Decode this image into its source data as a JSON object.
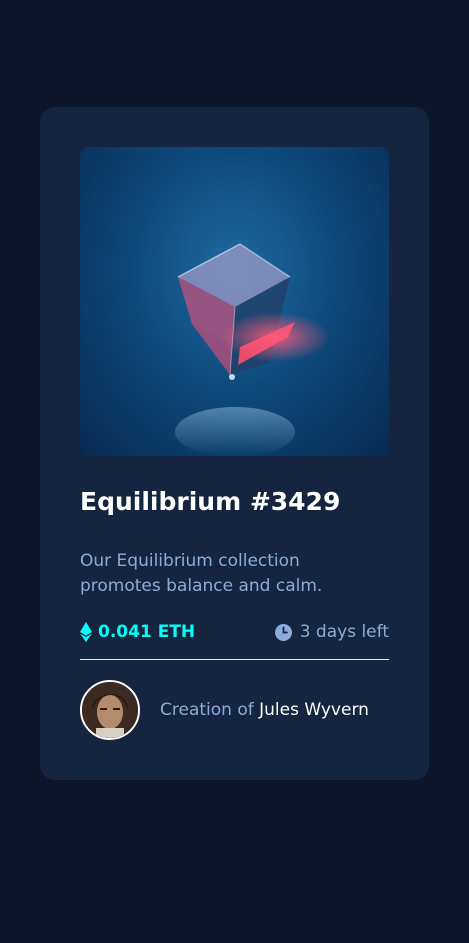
{
  "card": {
    "title": "Equilibrium #3429",
    "description": "Our Equilibrium collection promotes balance and calm.",
    "price": "0.041 ETH",
    "time_left": "3 days left",
    "creation_prefix": "Creation of",
    "creator_name": "Jules Wyvern"
  },
  "icons": {
    "price_icon": "ethereum-icon",
    "time_icon": "clock-icon"
  },
  "colors": {
    "background": "#0e1729",
    "card": "#15253f",
    "accent": "#00fff8",
    "muted": "#8bacd9",
    "white": "#ffffff"
  }
}
